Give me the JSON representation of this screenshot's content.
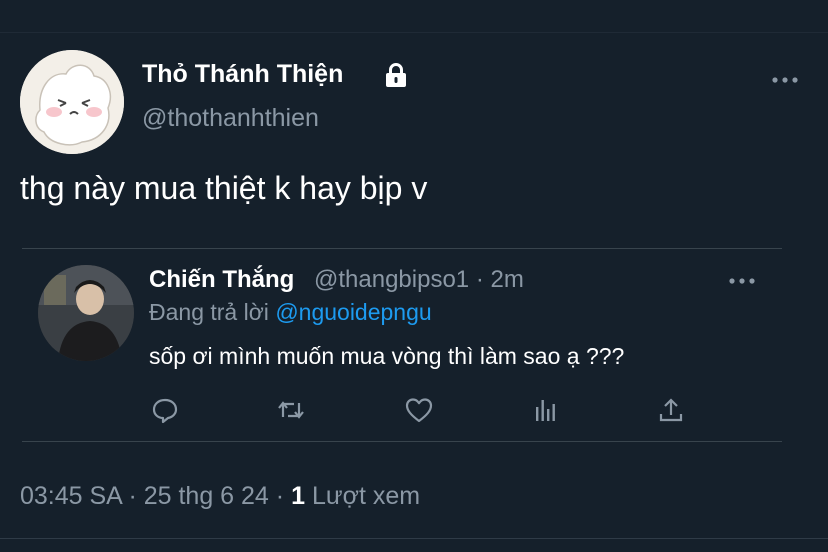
{
  "tweet": {
    "display_name": "Thỏ Thánh Thiện",
    "handle": "@thothanhthien",
    "text": "thg này mua thiệt k hay bịp v",
    "protected_icon": "lock-icon",
    "more_icon": "more-horizontal-icon"
  },
  "quoted": {
    "display_name": "Chiến Thắng",
    "meta": "@thangbipso1 · 2m",
    "replying_prefix": "Đang trả lời",
    "replying_to": "@nguoidepngu",
    "text": "sốp ơi mình muốn mua vòng thì làm sao ạ ???",
    "more_icon": "more-horizontal-icon",
    "actions": [
      "reply-icon",
      "retweet-icon",
      "like-icon",
      "analytics-icon",
      "share-icon"
    ]
  },
  "footer": {
    "time": "03:45 SA",
    "date": "25 thg 6 24",
    "views_count": "1",
    "views_label": "Lượt xem",
    "separator": "·"
  },
  "colors": {
    "background": "#15202b",
    "secondary_text": "#8b98a5",
    "link": "#1d9bf0",
    "border": "#38444d"
  }
}
